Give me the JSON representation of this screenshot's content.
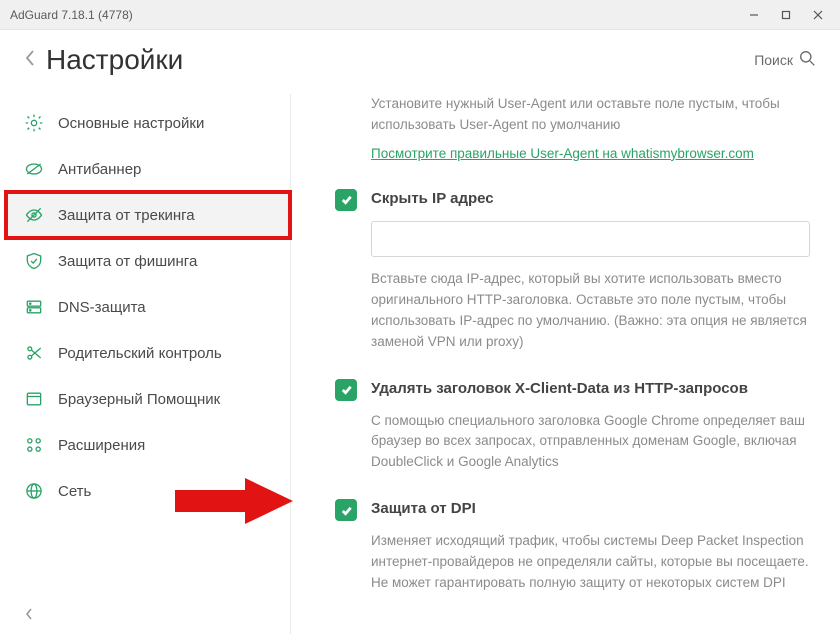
{
  "titlebar": {
    "title": "AdGuard 7.18.1 (4778)"
  },
  "header": {
    "title": "Настройки",
    "search_label": "Поиск"
  },
  "sidebar": {
    "items": [
      {
        "label": "Основные настройки"
      },
      {
        "label": "Антибаннер"
      },
      {
        "label": "Защита от трекинга"
      },
      {
        "label": "Защита от фишинга"
      },
      {
        "label": "DNS-защита"
      },
      {
        "label": "Родительский контроль"
      },
      {
        "label": "Браузерный Помощник"
      },
      {
        "label": "Расширения"
      },
      {
        "label": "Сеть"
      }
    ]
  },
  "content": {
    "ua_desc": "Установите нужный User-Agent или оставьте поле пустым, чтобы использовать User-Agent по умолчанию",
    "ua_link": "Посмотрите правильные User-Agent на whatismybrowser.com",
    "hide_ip": {
      "title": "Скрыть IP адрес",
      "input_value": "",
      "desc": "Вставьте сюда IP-адрес, который вы хотите использовать вместо оригинального HTTP-заголовка. Оставьте это поле пустым, чтобы использовать IP-адрес по умолчанию. (Важно: эта опция не является заменой VPN или proxy)"
    },
    "xclient": {
      "title": "Удалять заголовок X-Client-Data из HTTP-запросов",
      "desc": "С помощью специального заголовка Google Chrome определяет ваш браузер во всех запросах, отправленных доменам Google, включая DoubleClick и Google Analytics"
    },
    "dpi": {
      "title": "Защита от DPI",
      "desc": "Изменяет исходящий трафик, чтобы системы Deep Packet Inspection интернет-провайдеров не определяли сайты, которые вы посещаете. Не может гарантировать полную защиту от некоторых систем DPI"
    }
  }
}
